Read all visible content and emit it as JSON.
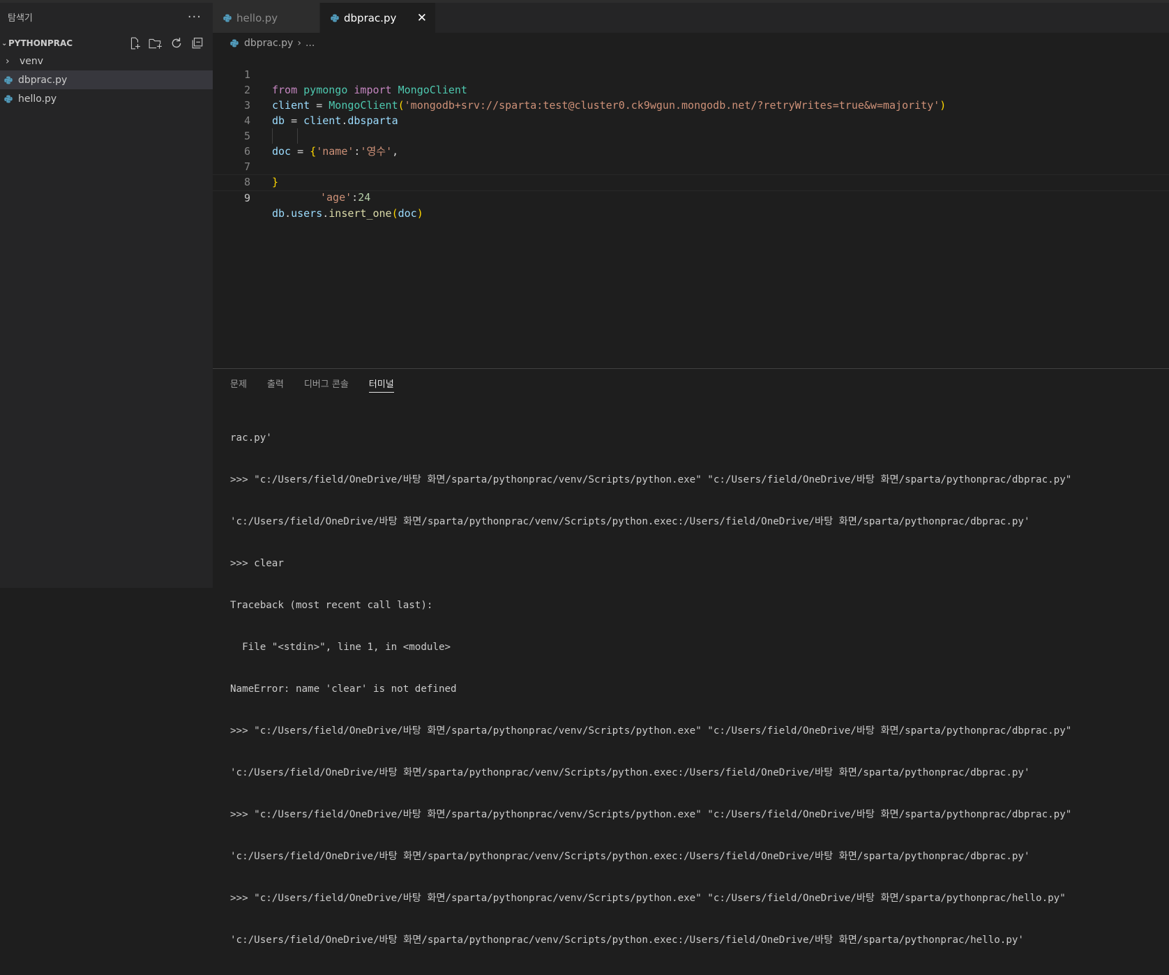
{
  "sidebar": {
    "title": "탐색기",
    "more": "···",
    "section": "PYTHONPRAC",
    "items": [
      {
        "label": "venv"
      },
      {
        "label": "dbprac.py"
      },
      {
        "label": "hello.py"
      }
    ]
  },
  "tabs": [
    {
      "label": "hello.py"
    },
    {
      "label": "dbprac.py",
      "close": "✕"
    }
  ],
  "breadcrumb": {
    "file": "dbprac.py",
    "sep": "›",
    "more": "..."
  },
  "editor": {
    "line_numbers": [
      "1",
      "2",
      "3",
      "4",
      "5",
      "6",
      "7",
      "8",
      "9"
    ],
    "code": {
      "l1": {
        "from": "from",
        "module": "pymongo",
        "import": "import",
        "cls": "MongoClient"
      },
      "l2": {
        "var": "client",
        "eq": " = ",
        "cls": "MongoClient",
        "open": "(",
        "str": "'mongodb+srv://sparta:test@cluster0.ck9wgun.mongodb.net/?retryWrites=true&w=majority'",
        "close": ")"
      },
      "l3": {
        "var": "db",
        "eq": " = ",
        "obj": "client",
        "dot": ".",
        "attr": "dbsparta"
      },
      "l5": {
        "var": "doc",
        "eq": " = ",
        "open": "{",
        "key": "'name'",
        "colon": ":",
        "val": "'영수'",
        "comma": ","
      },
      "l6": {
        "key": "'age'",
        "colon": ":",
        "val": "24"
      },
      "l7": {
        "close": "}"
      },
      "l9": {
        "obj": "db",
        "dot1": ".",
        "attr": "users",
        "dot2": ".",
        "fn": "insert_one",
        "open": "(",
        "arg": "doc",
        "close": ")"
      }
    }
  },
  "panel": {
    "tabs": [
      "문제",
      "출력",
      "디버그 콘솔",
      "터미널"
    ],
    "active_tab": "터미널",
    "terminal_lines": [
      "rac.py'",
      ">>> \"c:/Users/field/OneDrive/바탕 화면/sparta/pythonprac/venv/Scripts/python.exe\" \"c:/Users/field/OneDrive/바탕 화면/sparta/pythonprac/dbprac.py\"",
      "'c:/Users/field/OneDrive/바탕 화면/sparta/pythonprac/venv/Scripts/python.exec:/Users/field/OneDrive/바탕 화면/sparta/pythonprac/dbprac.py'",
      ">>> clear",
      "Traceback (most recent call last):",
      "  File \"<stdin>\", line 1, in <module>",
      "NameError: name 'clear' is not defined",
      ">>> \"c:/Users/field/OneDrive/바탕 화면/sparta/pythonprac/venv/Scripts/python.exe\" \"c:/Users/field/OneDrive/바탕 화면/sparta/pythonprac/dbprac.py\"",
      "'c:/Users/field/OneDrive/바탕 화면/sparta/pythonprac/venv/Scripts/python.exec:/Users/field/OneDrive/바탕 화면/sparta/pythonprac/dbprac.py'",
      ">>> \"c:/Users/field/OneDrive/바탕 화면/sparta/pythonprac/venv/Scripts/python.exe\" \"c:/Users/field/OneDrive/바탕 화면/sparta/pythonprac/dbprac.py\"",
      "'c:/Users/field/OneDrive/바탕 화면/sparta/pythonprac/venv/Scripts/python.exec:/Users/field/OneDrive/바탕 화면/sparta/pythonprac/dbprac.py'",
      ">>> \"c:/Users/field/OneDrive/바탕 화면/sparta/pythonprac/venv/Scripts/python.exe\" \"c:/Users/field/OneDrive/바탕 화면/sparta/pythonprac/hello.py\"",
      "'c:/Users/field/OneDrive/바탕 화면/sparta/pythonprac/venv/Scripts/python.exec:/Users/field/OneDrive/바탕 화면/sparta/pythonprac/hello.py'"
    ]
  },
  "icons": {
    "python_file": "python-file-icon",
    "new_file": "new-file-icon",
    "new_folder": "new-folder-icon",
    "refresh": "refresh-icon",
    "collapse": "collapse-all-icon"
  },
  "colors": {
    "python_icon": "#519aba",
    "keyword": "#c586c0",
    "class": "#4ec9b0",
    "variable": "#9cdcfe",
    "string": "#ce9178",
    "number": "#b5cea8",
    "function": "#dcdcaa",
    "bracket": "#ffd700"
  }
}
